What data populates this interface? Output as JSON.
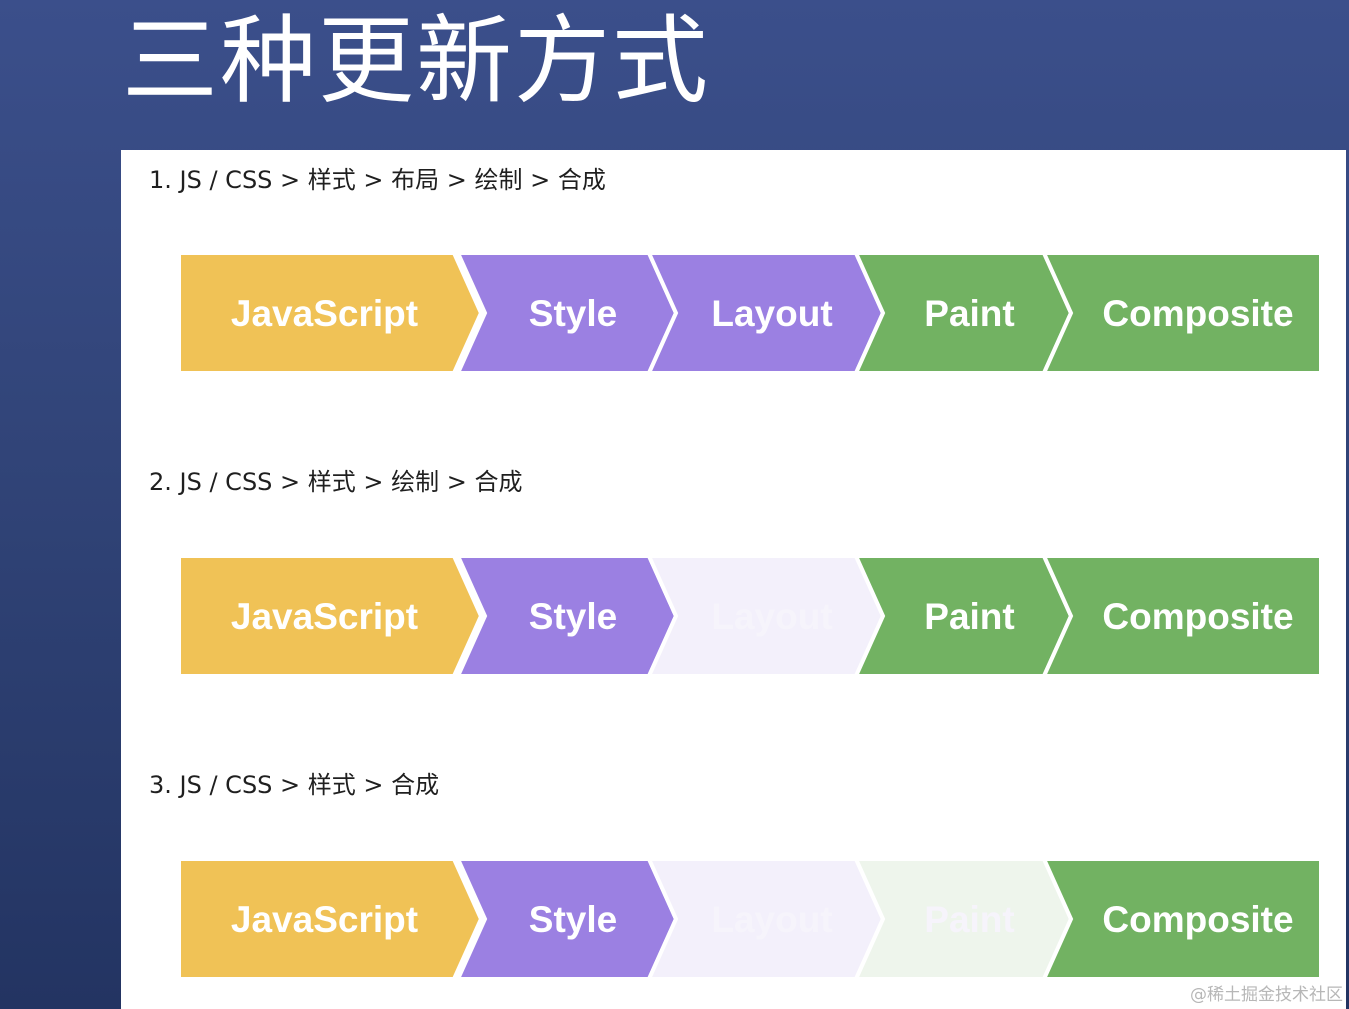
{
  "title": "三种更新方式",
  "colors": {
    "javascript": "#f0c256",
    "style": "#9b80e2",
    "layout": "#9b80e2",
    "paint": "#72b262",
    "composite": "#72b262",
    "faded_layout": "#f3f0fb",
    "faded_paint": "#eef5ec"
  },
  "sections": [
    {
      "label": "1. JS / CSS > 样式 > 布局 > 绘制 > 合成",
      "stages": [
        {
          "name": "JavaScript",
          "color": "#f0c256",
          "active": true
        },
        {
          "name": "Style",
          "color": "#9b80e2",
          "active": true
        },
        {
          "name": "Layout",
          "color": "#9b80e2",
          "active": true
        },
        {
          "name": "Paint",
          "color": "#72b262",
          "active": true
        },
        {
          "name": "Composite",
          "color": "#72b262",
          "active": true
        }
      ]
    },
    {
      "label": "2. JS / CSS > 样式 > 绘制 > 合成",
      "stages": [
        {
          "name": "JavaScript",
          "color": "#f0c256",
          "active": true
        },
        {
          "name": "Style",
          "color": "#9b80e2",
          "active": true
        },
        {
          "name": "Layout",
          "color": "#9b80e2",
          "active": false
        },
        {
          "name": "Paint",
          "color": "#72b262",
          "active": true
        },
        {
          "name": "Composite",
          "color": "#72b262",
          "active": true
        }
      ]
    },
    {
      "label": "3. JS / CSS > 样式 > 合成",
      "stages": [
        {
          "name": "JavaScript",
          "color": "#f0c256",
          "active": true
        },
        {
          "name": "Style",
          "color": "#9b80e2",
          "active": true
        },
        {
          "name": "Layout",
          "color": "#9b80e2",
          "active": false
        },
        {
          "name": "Paint",
          "color": "#72b262",
          "active": false
        },
        {
          "name": "Composite",
          "color": "#72b262",
          "active": true
        }
      ]
    }
  ],
  "watermark": "@稀土掘金技术社区"
}
